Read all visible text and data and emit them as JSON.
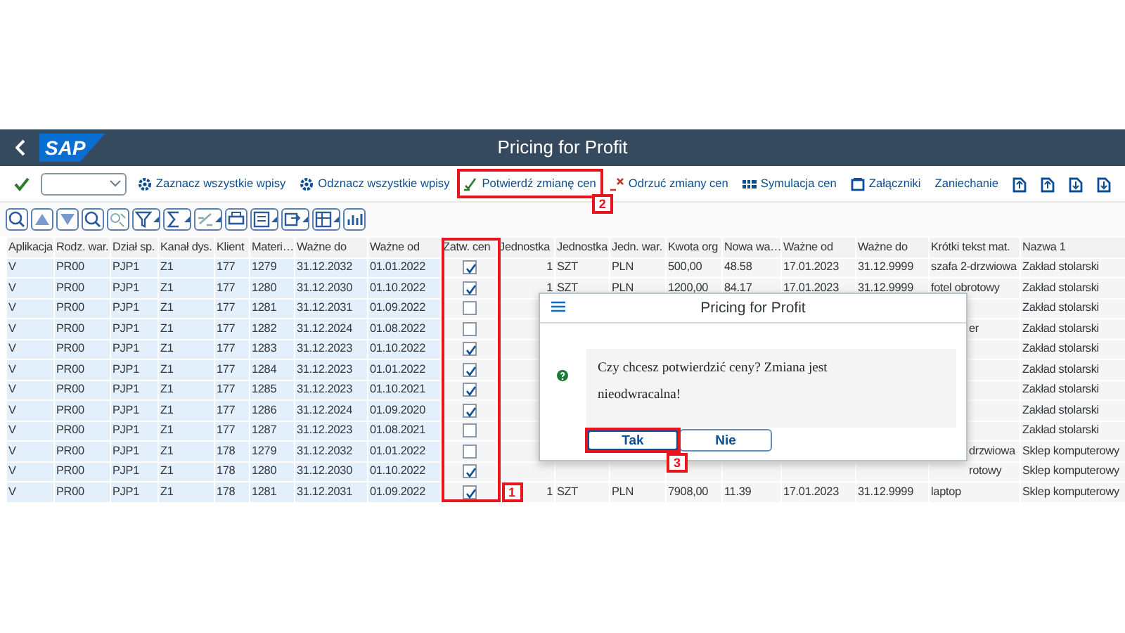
{
  "shell": {
    "logo": "SAP",
    "title": "Pricing for Profit"
  },
  "toolbar": {
    "buttons": [
      {
        "label": "Zaznacz wszystkie wpisy",
        "kind": "select-all"
      },
      {
        "label": "Odznacz wszystkie wpisy",
        "kind": "deselect-all"
      },
      {
        "label": "Potwierdź zmianę cen",
        "kind": "confirm",
        "callout": "2"
      },
      {
        "label": "Odrzuć zmiany cen",
        "kind": "reject"
      },
      {
        "label": "Symulacja cen",
        "kind": "simulate"
      },
      {
        "label": "Załączniki",
        "kind": "attach"
      },
      {
        "label": "Zaniechanie",
        "kind": "plain"
      }
    ]
  },
  "table": {
    "columns": [
      {
        "label": "Aplikacja",
        "kind": "key"
      },
      {
        "label": "Rodz. war.",
        "kind": "key"
      },
      {
        "label": "Dział sp.",
        "kind": "key"
      },
      {
        "label": "Kanał dys.",
        "kind": "key"
      },
      {
        "label": "Klient",
        "kind": "key"
      },
      {
        "label": "Materi…",
        "kind": "key"
      },
      {
        "label": "Ważne do",
        "kind": "key"
      },
      {
        "label": "Ważne od",
        "kind": "key"
      },
      {
        "label": "Zatw. cen",
        "kind": "check",
        "callout": "1"
      },
      {
        "label": "Jednostka",
        "kind": "num"
      },
      {
        "label": "Jednostka",
        "kind": "text"
      },
      {
        "label": "Jedn. war.",
        "kind": "text"
      },
      {
        "label": "Kwota org",
        "kind": "text"
      },
      {
        "label": "Nowa wa…",
        "kind": "text"
      },
      {
        "label": "Ważne od",
        "kind": "text"
      },
      {
        "label": "Ważne do",
        "kind": "text"
      },
      {
        "label": "Krótki tekst mat.",
        "kind": "text"
      },
      {
        "label": "Nazwa 1",
        "kind": "text"
      }
    ],
    "rows": [
      {
        "cells": [
          "V",
          "PR00",
          "PJP1",
          "Z1",
          "177",
          "1279",
          "31.12.2032",
          "01.01.2022",
          {
            "checked": true
          },
          "1",
          "SZT",
          "PLN",
          "500,00",
          "48.58",
          "17.01.2023",
          "31.12.9999",
          "szafa 2-drzwiowa",
          "Zakład stolarski"
        ]
      },
      {
        "cells": [
          "V",
          "PR00",
          "PJP1",
          "Z1",
          "177",
          "1280",
          "31.12.2030",
          "01.10.2022",
          {
            "checked": true
          },
          "1",
          "SZT",
          "PLN",
          "1200,00",
          "84.17",
          "17.01.2023",
          "31.12.9999",
          "fotel obrotowy",
          "Zakład stolarski"
        ]
      },
      {
        "cells": [
          "V",
          "PR00",
          "PJP1",
          "Z1",
          "177",
          "1281",
          "31.12.2031",
          "01.09.2022",
          {
            "checked": false
          },
          null,
          null,
          null,
          null,
          null,
          null,
          null,
          null,
          "Zakład stolarski"
        ]
      },
      {
        "cells": [
          "V",
          "PR00",
          "PJP1",
          "Z1",
          "177",
          "1282",
          "31.12.2024",
          "01.08.2022",
          {
            "checked": false
          },
          null,
          null,
          null,
          null,
          null,
          null,
          null,
          "er",
          "Zakład stolarski"
        ]
      },
      {
        "cells": [
          "V",
          "PR00",
          "PJP1",
          "Z1",
          "177",
          "1283",
          "31.12.2023",
          "01.10.2022",
          {
            "checked": true
          },
          null,
          null,
          null,
          null,
          null,
          null,
          null,
          null,
          "Zakład stolarski"
        ]
      },
      {
        "cells": [
          "V",
          "PR00",
          "PJP1",
          "Z1",
          "177",
          "1284",
          "31.12.2023",
          "01.01.2022",
          {
            "checked": true
          },
          null,
          null,
          null,
          null,
          null,
          null,
          null,
          null,
          "Zakład stolarski"
        ]
      },
      {
        "cells": [
          "V",
          "PR00",
          "PJP1",
          "Z1",
          "177",
          "1285",
          "31.12.2023",
          "01.10.2021",
          {
            "checked": true
          },
          null,
          null,
          null,
          null,
          null,
          null,
          null,
          null,
          "Zakład stolarski"
        ]
      },
      {
        "cells": [
          "V",
          "PR00",
          "PJP1",
          "Z1",
          "177",
          "1286",
          "31.12.2024",
          "01.09.2020",
          {
            "checked": true
          },
          null,
          null,
          null,
          null,
          null,
          null,
          null,
          null,
          "Zakład stolarski"
        ]
      },
      {
        "cells": [
          "V",
          "PR00",
          "PJP1",
          "Z1",
          "177",
          "1287",
          "31.12.2023",
          "01.08.2021",
          {
            "checked": false
          },
          null,
          null,
          null,
          null,
          null,
          null,
          null,
          null,
          "Zakład stolarski"
        ]
      },
      {
        "cells": [
          "V",
          "PR00",
          "PJP1",
          "Z1",
          "178",
          "1279",
          "31.12.2032",
          "01.01.2022",
          {
            "checked": false
          },
          null,
          null,
          null,
          null,
          null,
          null,
          null,
          "drzwiowa",
          "Sklep komputerowy"
        ]
      },
      {
        "cells": [
          "V",
          "PR00",
          "PJP1",
          "Z1",
          "178",
          "1280",
          "31.12.2030",
          "01.10.2022",
          {
            "checked": true
          },
          null,
          null,
          null,
          null,
          null,
          null,
          null,
          "rotowy",
          "Sklep komputerowy"
        ]
      },
      {
        "cells": [
          "V",
          "PR00",
          "PJP1",
          "Z1",
          "178",
          "1281",
          "31.12.2031",
          "01.09.2022",
          {
            "checked": true
          },
          "1",
          "SZT",
          "PLN",
          "7908,00",
          "11.39",
          "17.01.2023",
          "31.12.9999",
          "laptop",
          "Sklep komputerowy"
        ]
      }
    ]
  },
  "dialog": {
    "title": "Pricing for Profit",
    "message": "Czy chcesz potwierdzić ceny? Zmiana jest nieodwracalna!",
    "buttons": [
      {
        "label": "Tak",
        "selected": true,
        "callout": "3"
      },
      {
        "label": "Nie",
        "selected": false
      }
    ]
  }
}
